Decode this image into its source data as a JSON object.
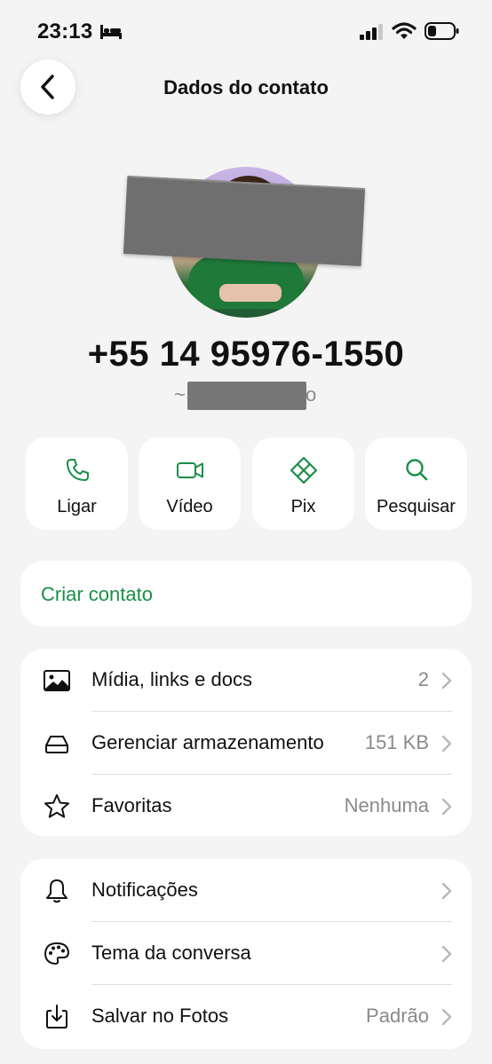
{
  "status_bar": {
    "time": "23:13",
    "icons": [
      "bed-icon",
      "signal-icon",
      "wifi-icon",
      "battery-icon"
    ]
  },
  "header": {
    "title": "Dados do contato",
    "back_icon": "chevron-left-icon"
  },
  "profile": {
    "phone": "+55 14 95976-1550",
    "username_prefix": "~",
    "username_suffix": "o"
  },
  "actions": [
    {
      "label": "Ligar",
      "icon": "phone-icon"
    },
    {
      "label": "Vídeo",
      "icon": "video-icon"
    },
    {
      "label": "Pix",
      "icon": "pix-icon"
    },
    {
      "label": "Pesquisar",
      "icon": "search-icon"
    }
  ],
  "create_contact": {
    "label": "Criar contato"
  },
  "media_section": [
    {
      "label": "Mídia, links e docs",
      "value": "2",
      "icon": "image-icon"
    },
    {
      "label": "Gerenciar armazenamento",
      "value": "151 KB",
      "icon": "storage-icon"
    },
    {
      "label": "Favoritas",
      "value": "Nenhuma",
      "icon": "star-icon"
    }
  ],
  "settings_section": [
    {
      "label": "Notificações",
      "value": "",
      "icon": "bell-icon"
    },
    {
      "label": "Tema da conversa",
      "value": "",
      "icon": "palette-icon"
    },
    {
      "label": "Salvar no Fotos",
      "value": "Padrão",
      "icon": "download-icon"
    }
  ],
  "colors": {
    "accent": "#1b8f48",
    "background": "#f4f4f4",
    "card": "#ffffff",
    "secondary_text": "#8a8a8a"
  }
}
